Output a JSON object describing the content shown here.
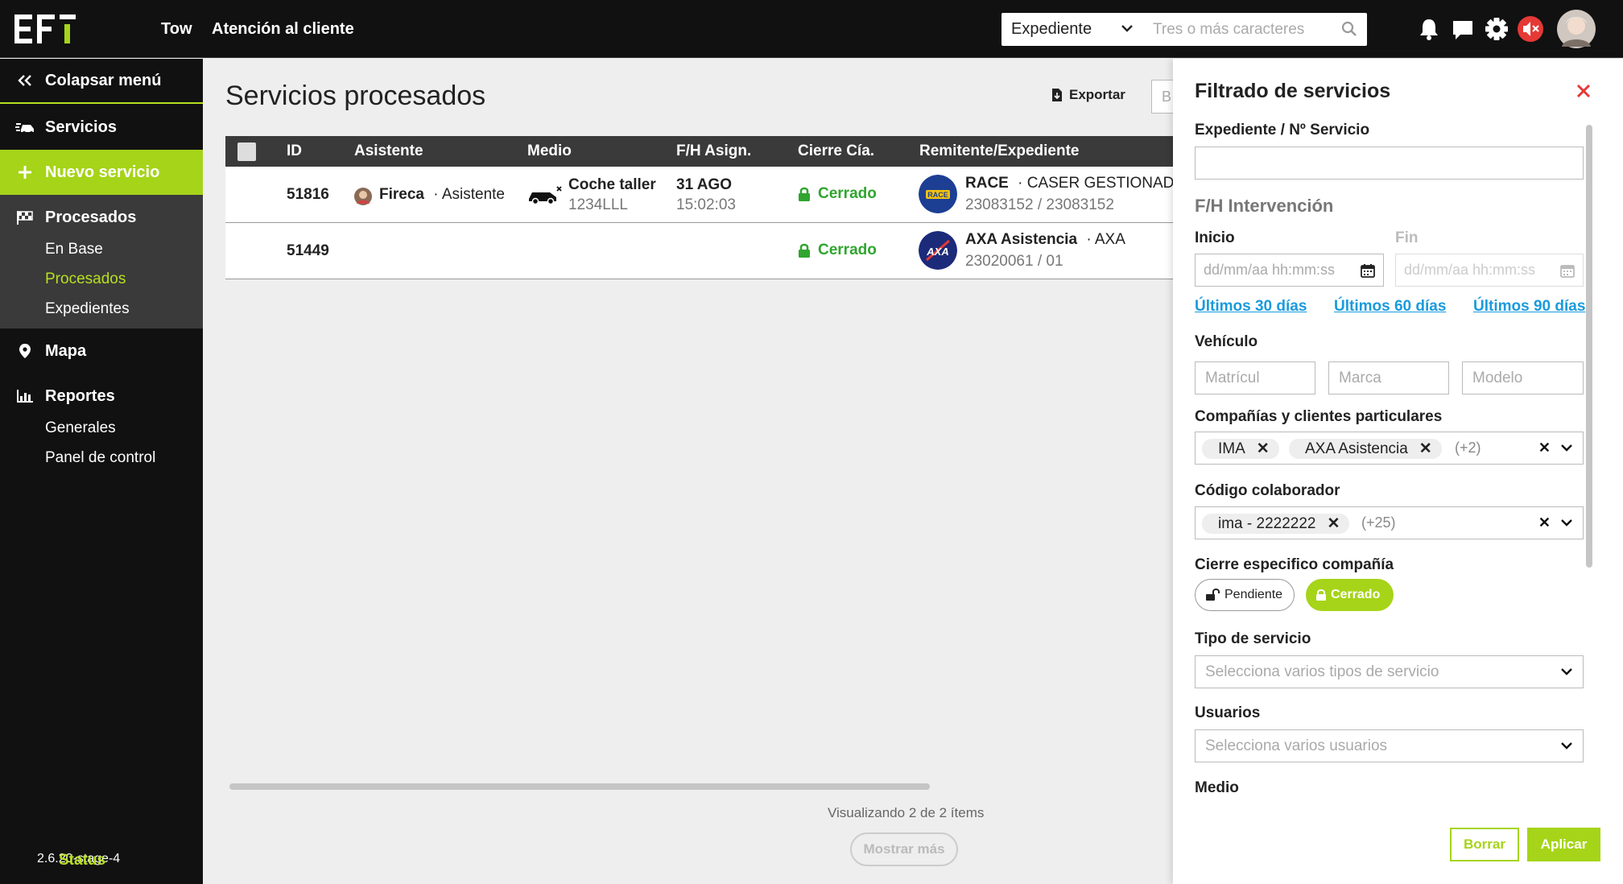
{
  "topbar": {
    "nav": [
      "Tow",
      "Atención al cliente"
    ],
    "search_select": "Expediente",
    "search_placeholder": "Tres o más caracteres",
    "icons": [
      "bell-icon",
      "chat-icon",
      "gear-icon",
      "mute-icon",
      "avatar"
    ],
    "mute_color": "#e53935"
  },
  "sidebar": {
    "collapse": "Colapsar menú",
    "servicios": "Servicios",
    "nuevo": "Nuevo servicio",
    "procesados": "Procesados",
    "procesados_sub": [
      "En Base",
      "Procesados",
      "Expedientes"
    ],
    "mapa": "Mapa",
    "reportes": "Reportes",
    "reportes_sub": [
      "Generales",
      "Panel de control"
    ],
    "status_label": "Status",
    "status_value": "2.6.20-stage-4",
    "accent": "#a6d419"
  },
  "main": {
    "title": "Servicios procesados",
    "export": "Exportar",
    "search_stub": "B",
    "columns": [
      "ID",
      "Asistente",
      "Medio",
      "F/H Asign.",
      "Cierre Cía.",
      "Remitente/Expediente"
    ],
    "rows": [
      {
        "id": "51816",
        "assistant_name": "Fireca",
        "assistant_role": "· Asistente",
        "medium": "Coche taller",
        "plate": "1234LLL",
        "date": "31 AGO",
        "time": "15:02:03",
        "status": "Cerrado",
        "sender": "RACE",
        "sender_sub": "· CASER GESTIONADO",
        "expediente": "23083152 / 23083152",
        "logo_text": "RACE"
      },
      {
        "id": "51449",
        "status": "Cerrado",
        "sender": "AXA Asistencia",
        "sender_sub": "· AXA",
        "expediente": "23020061 / 01",
        "logo_text": "AXA"
      }
    ],
    "showing": "Visualizando 2 de 2 ítems",
    "more": "Mostrar más"
  },
  "filter": {
    "title": "Filtrado de servicios",
    "expediente_label": "Expediente / Nº Servicio",
    "fh_label": "F/H Intervención",
    "inicio": "Inicio",
    "fin": "Fin",
    "date_placeholder": "dd/mm/aa hh:mm:ss",
    "quick": [
      "Últimos 30 días",
      "Últimos 60 días",
      "Últimos 90 días"
    ],
    "vehiculo": "Vehículo",
    "veh_placeholders": [
      "Matrícul",
      "Marca",
      "Modelo"
    ],
    "companias_label": "Compañías y clientes particulares",
    "companias_chips": [
      "IMA",
      "AXA Asistencia"
    ],
    "companias_more": "(+2)",
    "codigo_label": "Código colaborador",
    "codigo_chips": [
      "ima - 2222222"
    ],
    "codigo_more": "(+25)",
    "cierre_label": "Cierre especifico compañía",
    "pendiente": "Pendiente",
    "cerrado": "Cerrado",
    "tipo_label": "Tipo de servicio",
    "tipo_placeholder": "Selecciona varios tipos de servicio",
    "usuarios_label": "Usuarios",
    "usuarios_placeholder": "Selecciona varios usuarios",
    "medio_label": "Medio",
    "borrar": "Borrar",
    "aplicar": "Aplicar"
  }
}
